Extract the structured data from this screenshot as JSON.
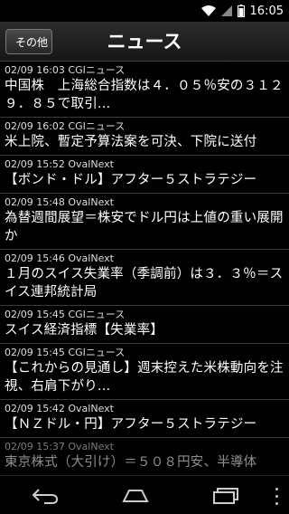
{
  "status_bar": {
    "time": "16:05"
  },
  "header": {
    "back_label": "その他",
    "title": "ニュース"
  },
  "news": [
    {
      "meta": "02/09 16:03 CGIニュース",
      "headline": "中国株　上海総合指数は４．０５％安の３１２９．８５で取引..."
    },
    {
      "meta": "02/09 16:02 CGIニュース",
      "headline": "米上院、暫定予算法案を可決、下院に送付"
    },
    {
      "meta": "02/09 15:52 OvalNext",
      "headline": "【ボンド・ドル】アフター５ストラテジー"
    },
    {
      "meta": "02/09 15:48 OvalNext",
      "headline": "為替週間展望＝株安でドル円は上値の重い展開か"
    },
    {
      "meta": "02/09 15:46 OvalNext",
      "headline": "１月のスイス失業率（季調前）は３．３％＝スイス連邦統計局"
    },
    {
      "meta": "02/09 15:45 CGIニュース",
      "headline": "スイス経済指標【失業率】"
    },
    {
      "meta": "02/09 15:45 CGIニュース",
      "headline": "【これからの見通し】週末控えた米株動向を注視、右肩下がり..."
    },
    {
      "meta": "02/09 15:42 OvalNext",
      "headline": "【ＮＺドル・円】アフター５ストラテジー"
    },
    {
      "meta": "02/09 15:37 OvalNext",
      "headline": "東京株式（大引け）＝５０８円安、半導体"
    }
  ],
  "nav": {
    "back_icon": "back-arrow-icon",
    "home_icon": "home-icon",
    "recents_icon": "recent-apps-icon"
  }
}
